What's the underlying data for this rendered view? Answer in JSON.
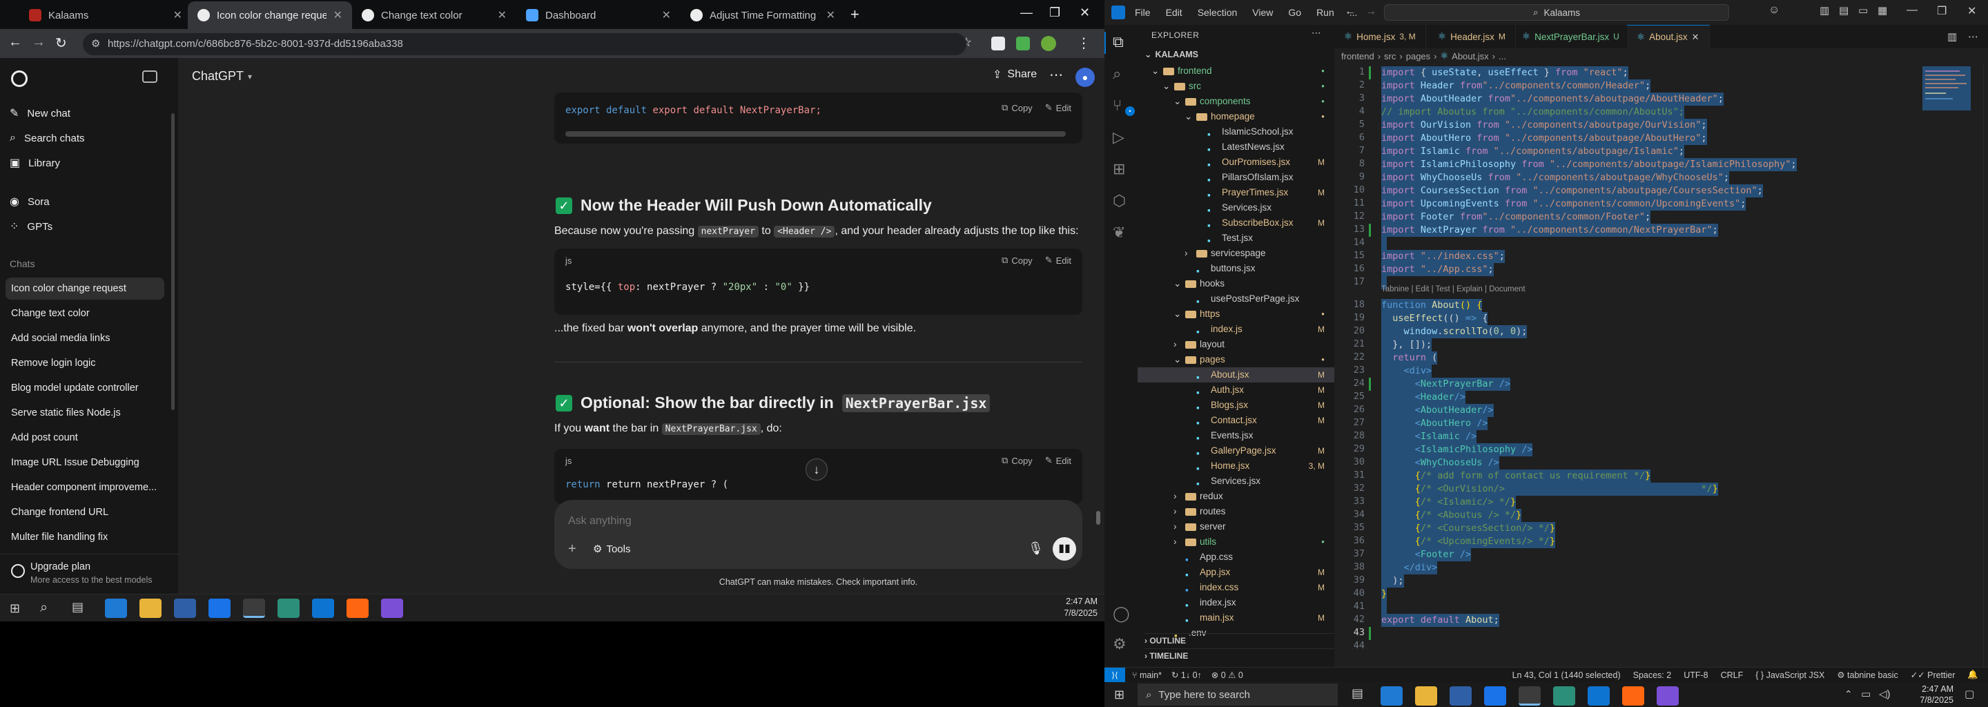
{
  "browser": {
    "tabs": [
      {
        "title": "Kalaams",
        "active": false
      },
      {
        "title": "Icon color change request",
        "active": true
      },
      {
        "title": "Change text color",
        "active": false
      },
      {
        "title": "Dashboard",
        "active": false
      },
      {
        "title": "Adjust Time Formatting for AM",
        "active": false
      }
    ],
    "new_tab": "+",
    "url": "https://chatgpt.com/c/686bc876-5b2c-8001-937d-dd5196aba338"
  },
  "chatgpt": {
    "sidebar": {
      "top_items": [
        {
          "label": "New chat",
          "icon": "new-chat-icon"
        },
        {
          "label": "Search chats",
          "icon": "search-icon"
        },
        {
          "label": "Library",
          "icon": "library-icon"
        },
        {
          "label": "Sora",
          "icon": "sora-icon"
        },
        {
          "label": "GPTs",
          "icon": "gpts-icon"
        }
      ],
      "chats_heading": "Chats",
      "chats": [
        "Icon color change request",
        "Change text color",
        "Add social media links",
        "Remove login logic",
        "Blog model update controller",
        "Serve static files Node.js",
        "Add post count",
        "Image URL Issue Debugging",
        "Header component improveme...",
        "Change frontend URL",
        "Multer file handling fix"
      ],
      "upgrade_title": "Upgrade plan",
      "upgrade_sub": "More access to the best models"
    },
    "header": {
      "model": "ChatGPT",
      "share": "Share"
    },
    "content": {
      "code1": {
        "line": "export default NextPrayerBar;",
        "copy": "Copy",
        "edit": "Edit"
      },
      "heading1": "Now the Header Will Push Down Automatically",
      "para1_a": "Because now you're passing",
      "para1_code1": "nextPrayer",
      "para1_b": "to",
      "para1_code2": "<Header />",
      "para1_c": ", and your header already adjusts the top like this:",
      "code2": {
        "lang": "js",
        "copy": "Copy",
        "edit": "Edit",
        "line_a": "style={{ ",
        "line_b": "top",
        "line_c": ": nextPrayer ? ",
        "line_d": "\"20px\"",
        "line_e": " : ",
        "line_f": "\"0\"",
        "line_g": " }}"
      },
      "para2_a": "...the fixed bar",
      "para2_b": "won't overlap",
      "para2_c": "anymore, and the prayer time will be visible.",
      "heading2_a": "Optional: Show the bar directly in",
      "heading2_code": "NextPrayerBar.jsx",
      "para3_a": "If you",
      "para3_b": "want",
      "para3_c": "the bar in",
      "para3_code": "NextPrayerBar.jsx",
      "para3_d": ", do:",
      "code3": {
        "lang": "js",
        "copy": "Copy",
        "edit": "Edit",
        "line": "return nextPrayer ? ("
      }
    },
    "composer": {
      "placeholder": "Ask anything",
      "tools": "Tools"
    },
    "disclaimer": "ChatGPT can make mistakes. Check important info."
  },
  "taskbar_left": {
    "time": "2:47 AM",
    "date": "7/8/2025"
  },
  "vscode": {
    "menu": [
      "File",
      "Edit",
      "Selection",
      "View",
      "Go",
      "Run",
      "..."
    ],
    "search": "Kalaams",
    "explorer_title": "EXPLORER",
    "root": "KALAAMS",
    "tree": [
      {
        "name": "frontend",
        "depth": 0,
        "type": "folder-open",
        "mark": "dot",
        "markColor": "#73c991"
      },
      {
        "name": "src",
        "depth": 1,
        "type": "folder-open",
        "mark": "dot",
        "markColor": "#73c991"
      },
      {
        "name": "components",
        "depth": 2,
        "type": "folder-open",
        "mark": "dot",
        "markColor": "#73c991"
      },
      {
        "name": "homepage",
        "depth": 3,
        "type": "folder-open",
        "mark": "dot",
        "markColor": "#e2c08d"
      },
      {
        "name": "IslamicSchool.jsx",
        "depth": 4,
        "type": "file",
        "mark": "",
        "markColor": ""
      },
      {
        "name": "LatestNews.jsx",
        "depth": 4,
        "type": "file",
        "mark": "",
        "markColor": ""
      },
      {
        "name": "OurPromises.jsx",
        "depth": 4,
        "type": "file",
        "mark": "M",
        "markColor": "#e2c08d"
      },
      {
        "name": "PillarsOfIslam.jsx",
        "depth": 4,
        "type": "file",
        "mark": "",
        "markColor": ""
      },
      {
        "name": "PrayerTimes.jsx",
        "depth": 4,
        "type": "file",
        "mark": "M",
        "markColor": "#e2c08d"
      },
      {
        "name": "Services.jsx",
        "depth": 4,
        "type": "file",
        "mark": "",
        "markColor": ""
      },
      {
        "name": "SubscribeBox.jsx",
        "depth": 4,
        "type": "file",
        "mark": "M",
        "markColor": "#e2c08d"
      },
      {
        "name": "Test.jsx",
        "depth": 4,
        "type": "file",
        "mark": "",
        "markColor": ""
      },
      {
        "name": "servicespage",
        "depth": 3,
        "type": "folder",
        "mark": "",
        "markColor": ""
      },
      {
        "name": "buttons.jsx",
        "depth": 3,
        "type": "file",
        "mark": "",
        "markColor": ""
      },
      {
        "name": "hooks",
        "depth": 2,
        "type": "folder-open",
        "mark": "",
        "markColor": ""
      },
      {
        "name": "usePostsPerPage.jsx",
        "depth": 3,
        "type": "file",
        "mark": "",
        "markColor": ""
      },
      {
        "name": "https",
        "depth": 2,
        "type": "folder-open",
        "mark": "dot",
        "markColor": "#e2c08d"
      },
      {
        "name": "index.js",
        "depth": 3,
        "type": "file",
        "mark": "M",
        "markColor": "#e2c08d"
      },
      {
        "name": "layout",
        "depth": 2,
        "type": "folder",
        "mark": "",
        "markColor": ""
      },
      {
        "name": "pages",
        "depth": 2,
        "type": "folder-open",
        "mark": "dot",
        "markColor": "#e2c08d"
      },
      {
        "name": "About.jsx",
        "depth": 3,
        "type": "file",
        "mark": "M",
        "markColor": "#e2c08d",
        "selected": true
      },
      {
        "name": "Auth.jsx",
        "depth": 3,
        "type": "file",
        "mark": "M",
        "markColor": "#e2c08d"
      },
      {
        "name": "Blogs.jsx",
        "depth": 3,
        "type": "file",
        "mark": "M",
        "markColor": "#e2c08d"
      },
      {
        "name": "Contact.jsx",
        "depth": 3,
        "type": "file",
        "mark": "M",
        "markColor": "#e2c08d"
      },
      {
        "name": "Events.jsx",
        "depth": 3,
        "type": "file",
        "mark": "",
        "markColor": ""
      },
      {
        "name": "GalleryPage.jsx",
        "depth": 3,
        "type": "file",
        "mark": "M",
        "markColor": "#e2c08d"
      },
      {
        "name": "Home.jsx",
        "depth": 3,
        "type": "file",
        "mark": "3, M",
        "markColor": "#e2c08d"
      },
      {
        "name": "Services.jsx",
        "depth": 3,
        "type": "file",
        "mark": "",
        "markColor": ""
      },
      {
        "name": "redux",
        "depth": 2,
        "type": "folder",
        "mark": "",
        "markColor": ""
      },
      {
        "name": "routes",
        "depth": 2,
        "type": "folder",
        "mark": "",
        "markColor": ""
      },
      {
        "name": "server",
        "depth": 2,
        "type": "folder",
        "mark": "",
        "markColor": ""
      },
      {
        "name": "utils",
        "depth": 2,
        "type": "folder",
        "mark": "dot",
        "markColor": "#73c991"
      },
      {
        "name": "App.css",
        "depth": 2,
        "type": "file",
        "mark": "",
        "markColor": ""
      },
      {
        "name": "App.jsx",
        "depth": 2,
        "type": "file",
        "mark": "M",
        "markColor": "#e2c08d"
      },
      {
        "name": "index.css",
        "depth": 2,
        "type": "file",
        "mark": "M",
        "markColor": "#e2c08d"
      },
      {
        "name": "index.jsx",
        "depth": 2,
        "type": "file",
        "mark": "",
        "markColor": ""
      },
      {
        "name": "main.jsx",
        "depth": 2,
        "type": "file",
        "mark": "M",
        "markColor": "#e2c08d"
      },
      {
        "name": ".env",
        "depth": 1,
        "type": "file",
        "mark": "",
        "markColor": ""
      }
    ],
    "outline": "OUTLINE",
    "timeline": "TIMELINE",
    "tabs": [
      {
        "label": "Home.jsx",
        "badge": "3, M",
        "active": false
      },
      {
        "label": "Header.jsx",
        "badge": "M",
        "active": false
      },
      {
        "label": "NextPrayerBar.jsx",
        "badge": "U",
        "active": false
      },
      {
        "label": "About.jsx",
        "badge": "",
        "active": true
      }
    ],
    "breadcrumb": [
      "frontend",
      "src",
      "pages",
      "About.jsx",
      "..."
    ],
    "codelens": "Tabnine | Edit | Test | Explain | Document",
    "status": {
      "branch": "main*",
      "sync": "1↓ 0↑",
      "problems": "0 ⚠ 0",
      "position": "Ln 43, Col 1 (1440 selected)",
      "spaces": "Spaces: 2",
      "encoding": "UTF-8",
      "eol": "CRLF",
      "language": "JavaScript JSX",
      "tabnine": "tabnine basic",
      "prettier": "Prettier"
    }
  },
  "taskbar_right": {
    "search": "Type here to search",
    "time": "2:47 AM",
    "date": "7/8/2025"
  }
}
